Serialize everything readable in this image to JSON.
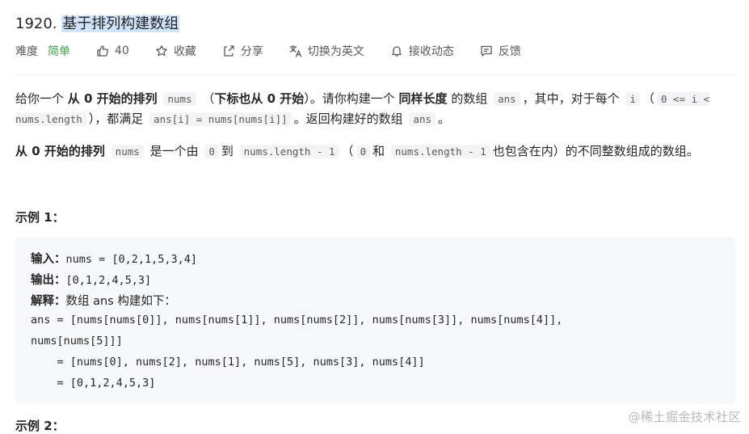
{
  "problem": {
    "number": "1920.",
    "title": "基于排列构建数组"
  },
  "meta": {
    "difficulty_label": "难度",
    "difficulty_value": "简单",
    "likes": "40",
    "favorite": "收藏",
    "share": "分享",
    "translate": "切换为英文",
    "notify": "接收动态",
    "feedback": "反馈",
    "colors": {
      "easy": "#43a047",
      "highlight": "#cfe3fb"
    },
    "icons": [
      "thumbs-up-icon",
      "star-icon",
      "share-icon",
      "translate-icon",
      "bell-icon",
      "feedback-icon"
    ]
  },
  "description": {
    "p1": {
      "t1": "给你一个 ",
      "b1": "从 0 开始的排列",
      "c1": "nums",
      "t2": "（",
      "b2": "下标也从 0 开始",
      "t3": "）。请你构建一个 ",
      "b3": "同样长度",
      "t4": " 的数组 ",
      "c2": "ans",
      "t5": "，其中，对于每个 ",
      "c3": "i",
      "t6": "（",
      "c4": "0 <= i < nums.length",
      "t7": "），都满足 ",
      "c5": "ans[i] = nums[nums[i]]",
      "t8": "。返回构建好的数组 ",
      "c6": "ans",
      "t9": "。"
    },
    "p2": {
      "b1": "从 0 开始的排列",
      "c1": "nums",
      "t1": "是一个由 ",
      "c2": "0",
      "t2": "到 ",
      "c3": "nums.length - 1",
      "t3": "（",
      "c4": "0",
      "t4": "和 ",
      "c5": "nums.length - 1",
      "t5": "也包含在内）的不同整数组成的数组。"
    }
  },
  "example1": {
    "title": "示例 1：",
    "input_label": "输入：",
    "input_value": "nums = [0,2,1,5,3,4]",
    "output_label": "输出：",
    "output_value": "[0,1,2,4,5,3]",
    "explain_label": "解释：",
    "explain_text": "数组 ans 构建如下：",
    "line1": "ans = [nums[nums[0]], nums[nums[1]], nums[nums[2]], nums[nums[3]], nums[nums[4]],",
    "line2": "nums[nums[5]]]",
    "line3": "    = [nums[0], nums[2], nums[1], nums[5], nums[3], nums[4]]",
    "line4": "    = [0,1,2,4,5,3]"
  },
  "example2": {
    "title": "示例 2："
  },
  "watermark": "@稀土掘金技术社区"
}
